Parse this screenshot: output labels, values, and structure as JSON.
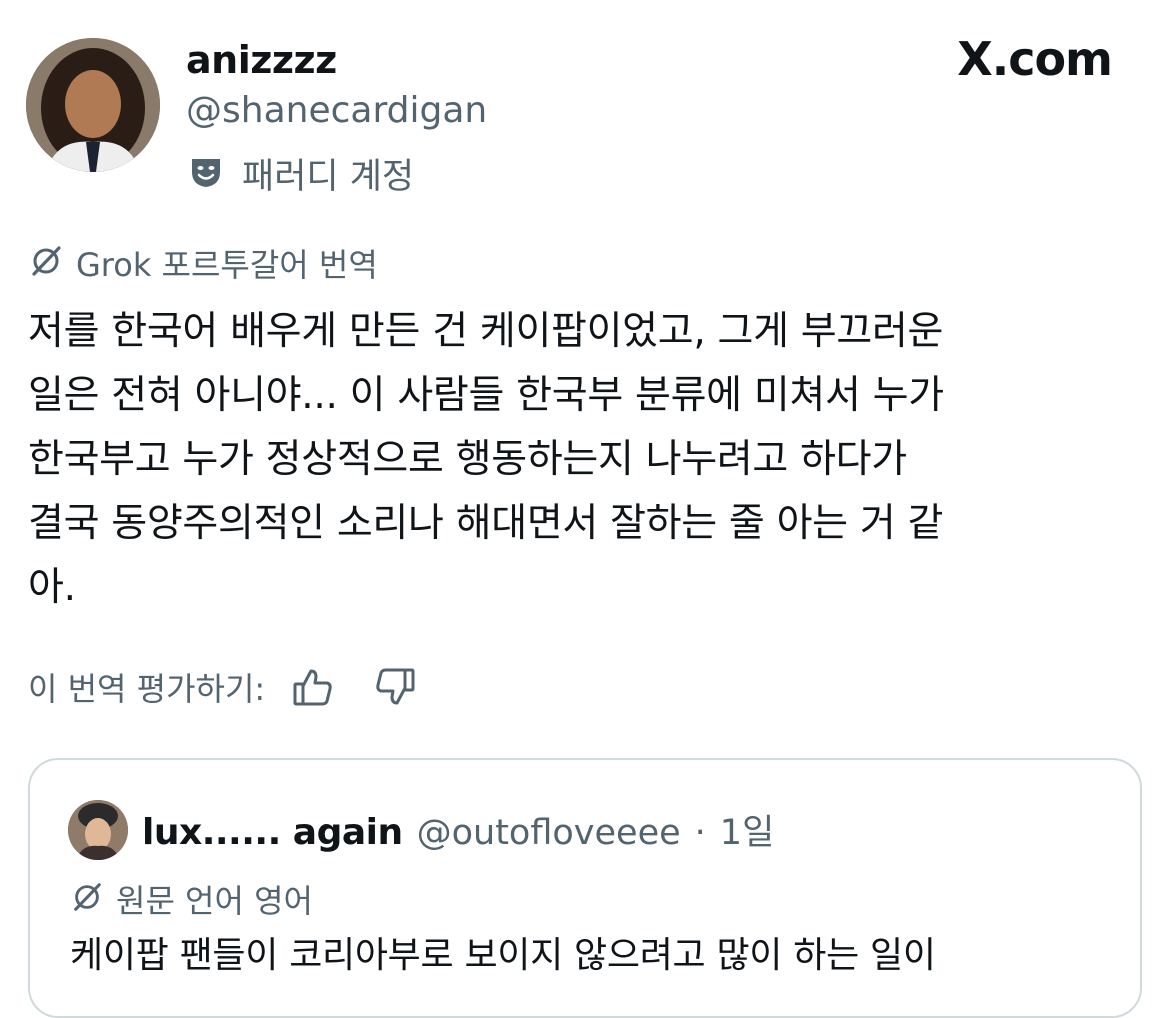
{
  "tweet": {
    "display_name": "anizzzz",
    "handle": "@shanecardigan",
    "parody_label": "패러디 계정",
    "translated_label": "Grok 포르투갈어 번역",
    "text": "저를 한국어 배우게 만든 건 케이팝이었고, 그게 부끄러운\n일은 전혀 아니야... 이 사람들 한국부 분류에 미쳐서 누가\n한국부고 누가 정상적으로 행동하는지 나누려고 하다가\n결국 동양주의적인 소리나 해대면서 잘하는 줄 아는 거 같\n아.",
    "rate_label": "이 번역 평가하기:"
  },
  "brand": "X.com",
  "quote": {
    "display_name": "lux...... again",
    "handle": "@outofloveeee",
    "separator": "·",
    "time": "1일",
    "original_lang_label": "원문 언어 영어",
    "text": "케이팝 팬들이 코리아부로 보이지 않으려고 많이 하는 일이"
  },
  "colors": {
    "text_primary": "#0f1419",
    "text_secondary": "#536471",
    "border": "#cfd9de",
    "background": "#ffffff"
  },
  "icons": {
    "parody": "theater-mask-icon",
    "translate": "grok-slash-icon",
    "thumbs_up": "thumbs-up-icon",
    "thumbs_down": "thumbs-down-icon"
  }
}
